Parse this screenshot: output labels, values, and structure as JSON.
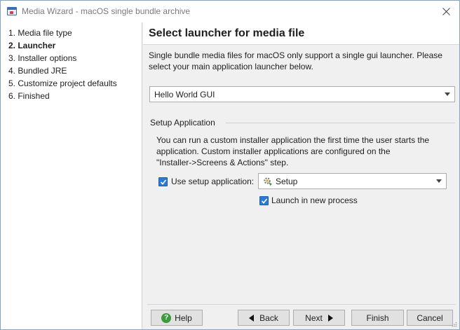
{
  "window": {
    "title": "Media Wizard - macOS single bundle archive"
  },
  "steps": [
    {
      "label": "1. Media file type",
      "active": false
    },
    {
      "label": "2. Launcher",
      "active": true
    },
    {
      "label": "3. Installer options",
      "active": false
    },
    {
      "label": "4. Bundled JRE",
      "active": false
    },
    {
      "label": "5. Customize project defaults",
      "active": false
    },
    {
      "label": "6. Finished",
      "active": false
    }
  ],
  "header": {
    "title": "Select launcher for media file"
  },
  "description": {
    "line1": "Single bundle media files for macOS only support a single gui launcher. Please",
    "line2": "select your main application launcher below."
  },
  "launcher_select": {
    "value": "Hello World GUI"
  },
  "setup_group": {
    "label": "Setup Application",
    "desc_line1": "You can run a custom installer application the first time the user starts the",
    "desc_line2": "application. Custom installer applications are configured on the",
    "desc_line3": "\"Installer->Screens & Actions\" step.",
    "use_setup_label": "Use setup application:",
    "use_setup_checked": true,
    "setup_select_value": "Setup",
    "launch_new_process_label": "Launch in new process",
    "launch_new_process_checked": true
  },
  "buttons": {
    "help": "Help",
    "back": "Back",
    "next": "Next",
    "finish": "Finish",
    "cancel": "Cancel"
  },
  "icons": {
    "help": "help-icon",
    "back": "arrow-left-icon",
    "next": "arrow-right-icon",
    "close": "close-icon",
    "setup": "gear-icon",
    "check": "check-icon"
  },
  "colors": {
    "accent": "#2c7ad6",
    "help_green": "#3c9a3c"
  }
}
